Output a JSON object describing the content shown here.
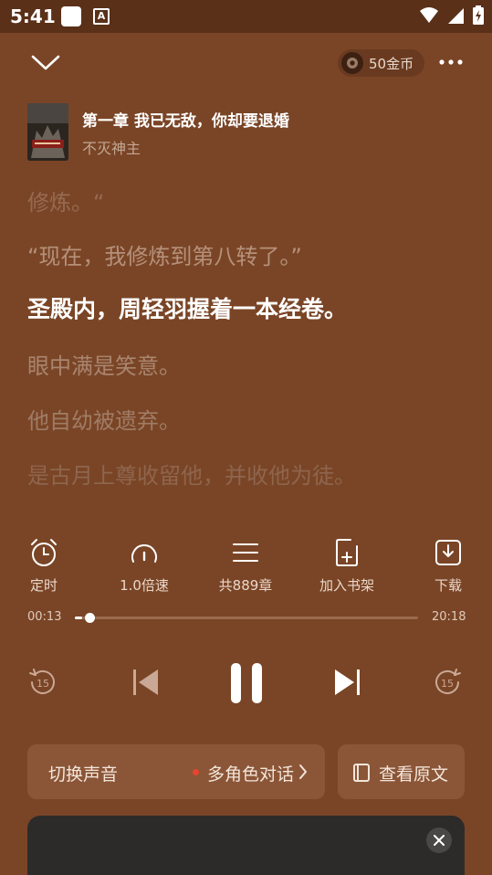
{
  "status_bar": {
    "time": "5:41"
  },
  "header": {
    "coins_label": "50金币"
  },
  "book": {
    "title": "第一章 我已无敌，你却要退婚",
    "author": "不灭神主"
  },
  "lyrics": [
    "修炼。“",
    "“现在，我修炼到第八转了。”",
    "圣殿内，周轻羽握着一本经卷。",
    "眼中满是笑意。",
    "他自幼被遗弃。",
    "是古月上尊收留他，并收他为徒。"
  ],
  "active_lyric_index": 2,
  "controls": {
    "timer_label": "定时",
    "speed_label": "1.0倍速",
    "chapters_label": "共889章",
    "bookshelf_label": "加入书架",
    "download_label": "下载"
  },
  "progress": {
    "current": "00:13",
    "total": "20:18",
    "fraction": 0.02
  },
  "playback": {
    "rewind_seconds": "15",
    "forward_seconds": "15",
    "state": "playing"
  },
  "voice": {
    "label": "切换声音",
    "value": "多角色对话"
  },
  "original_text_label": "查看原文",
  "colors": {
    "background": "#7a4526",
    "panel": "#8b5638",
    "accent_dot": "#e8442e"
  }
}
